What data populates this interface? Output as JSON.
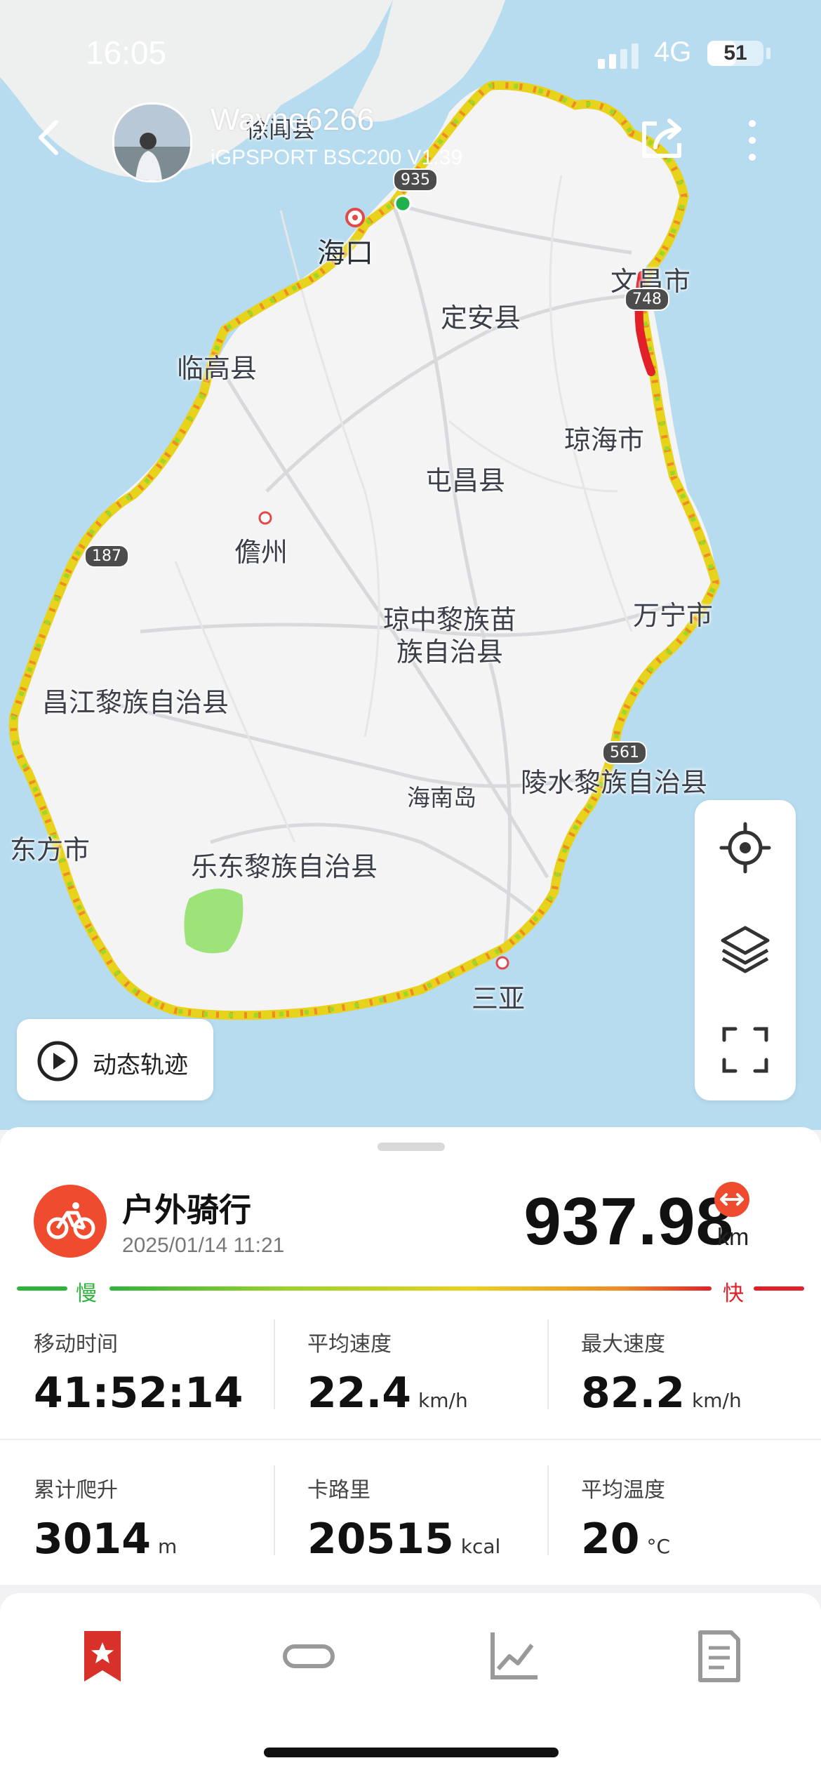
{
  "status_bar": {
    "time": "16:05",
    "network": "4G",
    "battery": "51",
    "battery_level": 0.51
  },
  "header": {
    "username": "Wayne6266",
    "device": "iGPSPORT BSC200 V1.39"
  },
  "map": {
    "labels": {
      "lingao": "临高县",
      "xuwen": "徐闻县",
      "haikou": "海口",
      "dingan": "定安县",
      "wenchang": "文昌市",
      "qionghai": "琼海市",
      "tunchang": "屯昌县",
      "danzhou": "儋州",
      "qiongzhong": "琼中黎族苗族自治县",
      "wanning": "万宁市",
      "changjiang": "昌江黎族自治县",
      "lingshui": "陵水黎族自治县",
      "hainandao": "海南岛",
      "dongfang": "东方市",
      "ledong": "乐东黎族自治县",
      "sanya": "三亚"
    },
    "roads": {
      "r935": "935",
      "r748": "748",
      "r187": "187",
      "r561": "561"
    },
    "dynamic_track_label": "动态轨迹",
    "route_colors": {
      "slow": "#2fb33a",
      "medium": "#e8d21c",
      "fast": "#e2202a"
    }
  },
  "activity": {
    "type": "户外骑行",
    "datetime": "2025/01/14 11:21",
    "distance": "937.98",
    "distance_unit": "km",
    "accent": "#ef4b2f"
  },
  "speed_scale": {
    "slow": "慢",
    "fast": "快"
  },
  "stats": [
    {
      "label": "移动时间",
      "value": "41:52:14",
      "unit": ""
    },
    {
      "label": "平均速度",
      "value": "22.4",
      "unit": "km/h"
    },
    {
      "label": "最大速度",
      "value": "82.2",
      "unit": "km/h"
    },
    {
      "label": "累计爬升",
      "value": "3014",
      "unit": "m"
    },
    {
      "label": "卡路里",
      "value": "20515",
      "unit": "kcal"
    },
    {
      "label": "平均温度",
      "value": "20",
      "unit": "°C"
    }
  ],
  "tabs": [
    {
      "icon": "bookmark-star-icon",
      "active": true
    },
    {
      "icon": "segment-icon",
      "active": false
    },
    {
      "icon": "chart-line-icon",
      "active": false
    },
    {
      "icon": "document-icon",
      "active": false
    }
  ]
}
